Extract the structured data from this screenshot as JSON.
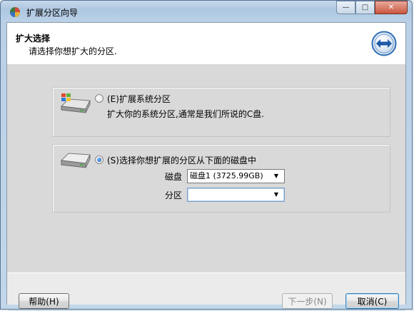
{
  "window": {
    "title": "扩展分区向导",
    "controls": {
      "minimize": "—",
      "maximize": "□",
      "close": "✕"
    }
  },
  "header": {
    "title": "扩大选择",
    "subtitle": "请选择你想扩大的分区."
  },
  "option1": {
    "label": "(E)扩展系统分区",
    "description": "扩大你的系统分区,通常是我们所说的C盘.",
    "selected": false
  },
  "option2": {
    "label": "(S)选择你想扩展的分区从下面的磁盘中",
    "selected": true,
    "disk_label": "磁盘",
    "disk_value": "磁盘1 (3725.99GB)",
    "partition_label": "分区",
    "partition_value": ""
  },
  "footer": {
    "help": "帮助(H)",
    "next": "下一步(N)",
    "cancel": "取消(C)"
  },
  "icons": {
    "app": "partition-wizard-app-icon",
    "header": "expand-arrows-icon",
    "system_drive": "windows-drive-icon",
    "disk_drive": "hard-disk-icon"
  },
  "colors": {
    "accent": "#2f6fb5",
    "header_bg": "#ffffff",
    "content_bg": "#d9d9d9"
  }
}
